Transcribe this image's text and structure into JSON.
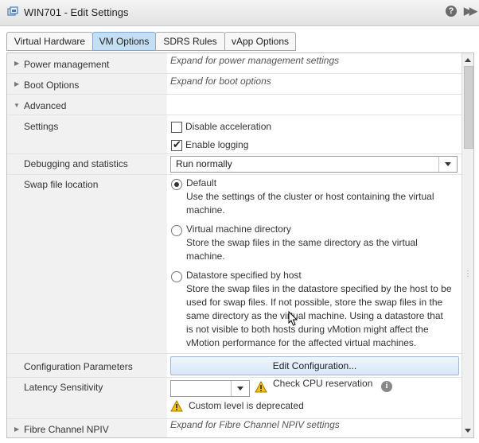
{
  "window": {
    "title": "WIN701 - Edit Settings",
    "help_glyph": "?",
    "expand_glyph": "▶▶"
  },
  "tabs": [
    {
      "label": "Virtual Hardware",
      "active": false
    },
    {
      "label": "VM Options",
      "active": true
    },
    {
      "label": "SDRS Rules",
      "active": false
    },
    {
      "label": "vApp Options",
      "active": false
    }
  ],
  "sections": {
    "power": {
      "label": "Power management",
      "desc": "Expand for power management settings"
    },
    "boot": {
      "label": "Boot Options",
      "desc": "Expand for boot options"
    },
    "advanced": {
      "label": "Advanced"
    },
    "settings": {
      "label": "Settings",
      "disable_acceleration": {
        "label": "Disable acceleration",
        "checked": false
      },
      "enable_logging": {
        "label": "Enable logging",
        "checked": true
      }
    },
    "debugging": {
      "label": "Debugging and statistics",
      "value": "Run normally"
    },
    "swap": {
      "label": "Swap file location",
      "options": [
        {
          "label": "Default",
          "desc": [
            "Use the settings of the cluster or host containing the virtual",
            "machine."
          ],
          "selected": true
        },
        {
          "label": "Virtual machine directory",
          "desc": [
            "Store the swap files in the same directory as the virtual",
            "machine."
          ],
          "selected": false
        },
        {
          "label": "Datastore specified by host",
          "desc": [
            "Store the swap files in the datastore specified by the host to be",
            "used for swap files. If not possible, store the swap files in the",
            "same directory as the virtual machine. Using a datastore that",
            "is not visible to both hosts during vMotion might affect the",
            "vMotion performance for the affected virtual machines."
          ],
          "selected": false
        }
      ]
    },
    "config": {
      "label": "Configuration Parameters",
      "button": "Edit Configuration..."
    },
    "latency": {
      "label": "Latency Sensitivity",
      "value": "",
      "warning_cpu": "Check CPU reservation",
      "warning_custom": "Custom level is deprecated"
    },
    "fibre": {
      "label": "Fibre Channel NPIV",
      "desc": "Expand for Fibre Channel NPIV settings"
    }
  },
  "colors": {
    "active_tab": "#c4dff4",
    "label_bg": "#f1f1f1",
    "warning": "#f4c20d"
  }
}
